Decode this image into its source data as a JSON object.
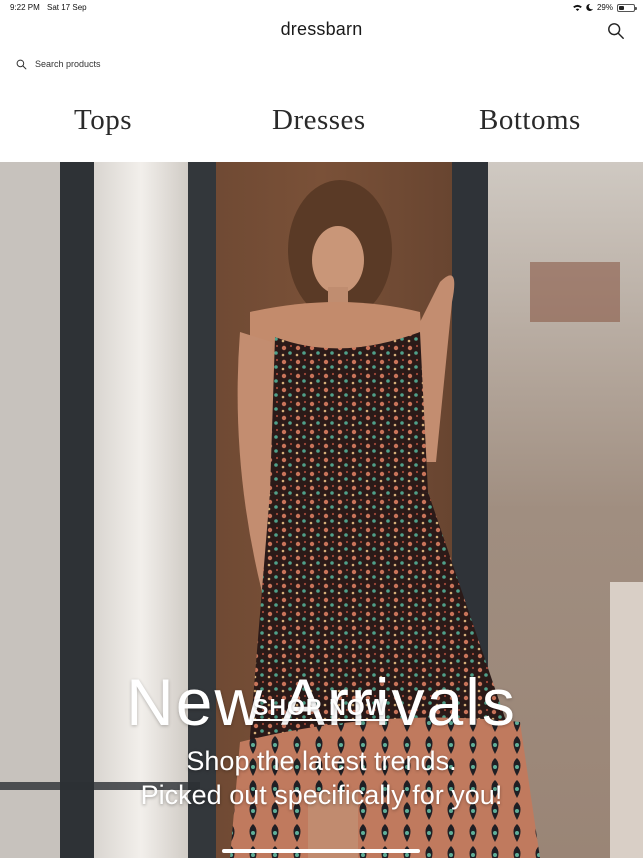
{
  "status_bar": {
    "time": "9:22 PM",
    "date": "Sat 17 Sep",
    "battery": "29%",
    "battery_level": 0.29,
    "icons": [
      "wifi-icon",
      "moon-icon",
      "battery-icon"
    ]
  },
  "header": {
    "logo": "dressbarn",
    "search_icon": "search-icon"
  },
  "search": {
    "placeholder": "Search products",
    "icon": "search-icon"
  },
  "categories": [
    {
      "label": "Tops"
    },
    {
      "label": "Dresses"
    },
    {
      "label": "Bottoms"
    }
  ],
  "hero": {
    "title": "New Arrivals",
    "subtitle_line1": "Shop the latest trends.",
    "subtitle_line2": "Picked out specifically for you!",
    "cta": "SHOP NOW"
  },
  "colors": {
    "background": "#ffffff",
    "text": "#222222",
    "hero_text": "#ffffff"
  }
}
